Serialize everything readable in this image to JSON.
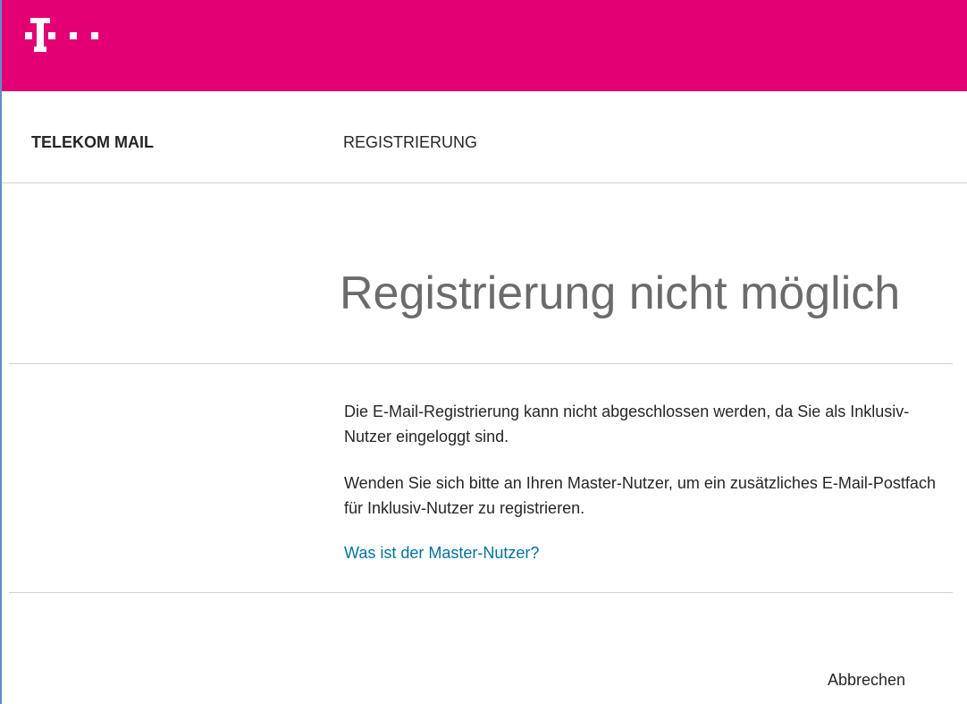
{
  "header": {
    "brand_color": "#e20074",
    "logo_icon": "telekom-t-logo-icon"
  },
  "nav": {
    "app_name": "TELEKOM MAIL",
    "page_name": "REGISTRIERUNG"
  },
  "main": {
    "title": "Registrierung nicht möglich",
    "paragraph_1": "Die E-Mail-Registrierung kann nicht abgeschlossen werden, da Sie als Inklusiv-Nutzer eingeloggt sind.",
    "paragraph_2": "Wenden Sie sich bitte an Ihren Master-Nutzer, um ein zusätzliches E-Mail-Postfach für Inklusiv-Nutzer zu registrieren.",
    "help_link": "Was ist der Master-Nutzer?",
    "link_color": "#00739f"
  },
  "footer": {
    "cancel_label": "Abbrechen"
  }
}
